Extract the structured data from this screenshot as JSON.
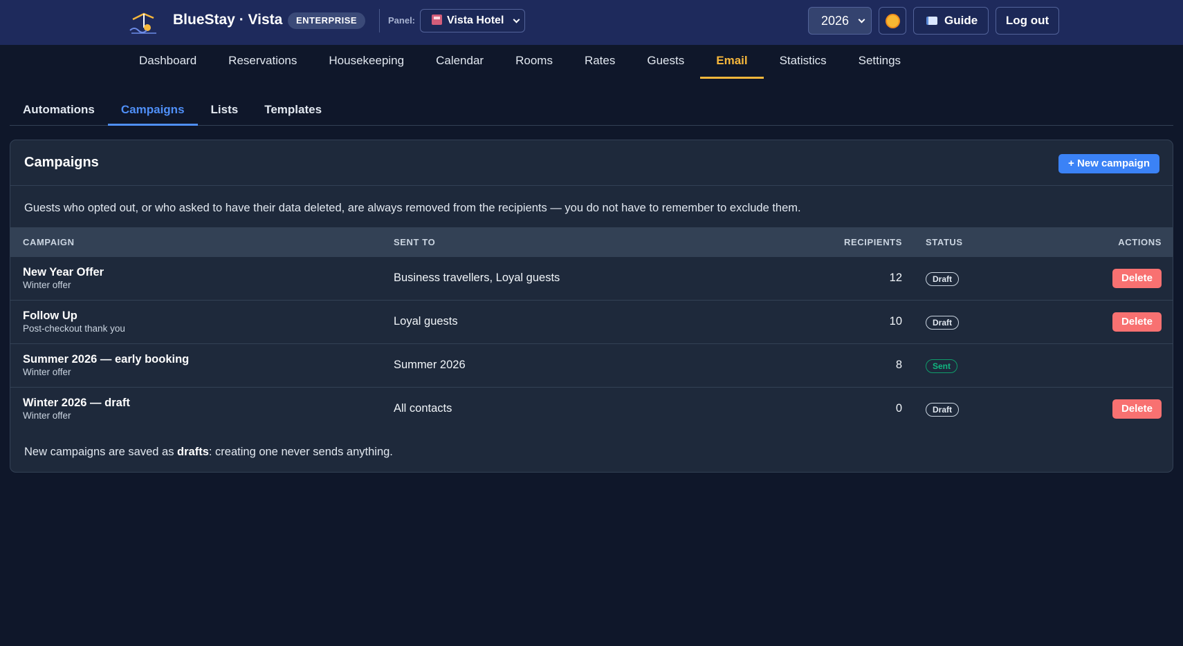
{
  "header": {
    "brand": "BlueStay · Vista",
    "edition": "ENTERPRISE",
    "panel_label": "Panel:",
    "panel_value": "Vista Hotel",
    "year": "2026",
    "guide_label": "Guide",
    "logout_label": "Log out"
  },
  "nav": {
    "items": [
      "Dashboard",
      "Reservations",
      "Housekeeping",
      "Calendar",
      "Rooms",
      "Rates",
      "Guests",
      "Email",
      "Statistics",
      "Settings"
    ],
    "active": "Email"
  },
  "subnav": {
    "items": [
      "Automations",
      "Campaigns",
      "Lists",
      "Templates"
    ],
    "active": "Campaigns"
  },
  "card": {
    "title": "Campaigns",
    "new_button": "+ New campaign",
    "note": "Guests who opted out, or who asked to have their data deleted, are always removed from the recipients — you do not have to remember to exclude them.",
    "columns": {
      "campaign": "CAMPAIGN",
      "sent_to": "SENT TO",
      "recipients": "RECIPIENTS",
      "status": "STATUS",
      "actions": "ACTIONS"
    },
    "rows": [
      {
        "name": "New Year Offer",
        "template": "Winter offer",
        "sent_to": "Business travellers, Loyal guests",
        "recipients": "12",
        "status": "Draft",
        "action": "Delete"
      },
      {
        "name": "Follow Up",
        "template": "Post-checkout thank you",
        "sent_to": "Loyal guests",
        "recipients": "10",
        "status": "Draft",
        "action": "Delete"
      },
      {
        "name": "Summer 2026 — early booking",
        "template": "Winter offer",
        "sent_to": "Summer 2026",
        "recipients": "8",
        "status": "Sent",
        "action": ""
      },
      {
        "name": "Winter 2026 — draft",
        "template": "Winter offer",
        "sent_to": "All contacts",
        "recipients": "0",
        "status": "Draft",
        "action": "Delete"
      }
    ],
    "footer_before": "New campaigns are saved as ",
    "footer_bold": "drafts",
    "footer_after": ": creating one never sends anything."
  },
  "colors": {
    "header_bg": "#1e2a5c",
    "page_bg": "#0f172a",
    "active_nav": "#f6b73c",
    "active_tab": "#4f8ff7",
    "primary": "#3b82f6",
    "danger": "#f87171",
    "sent": "#10b981"
  }
}
